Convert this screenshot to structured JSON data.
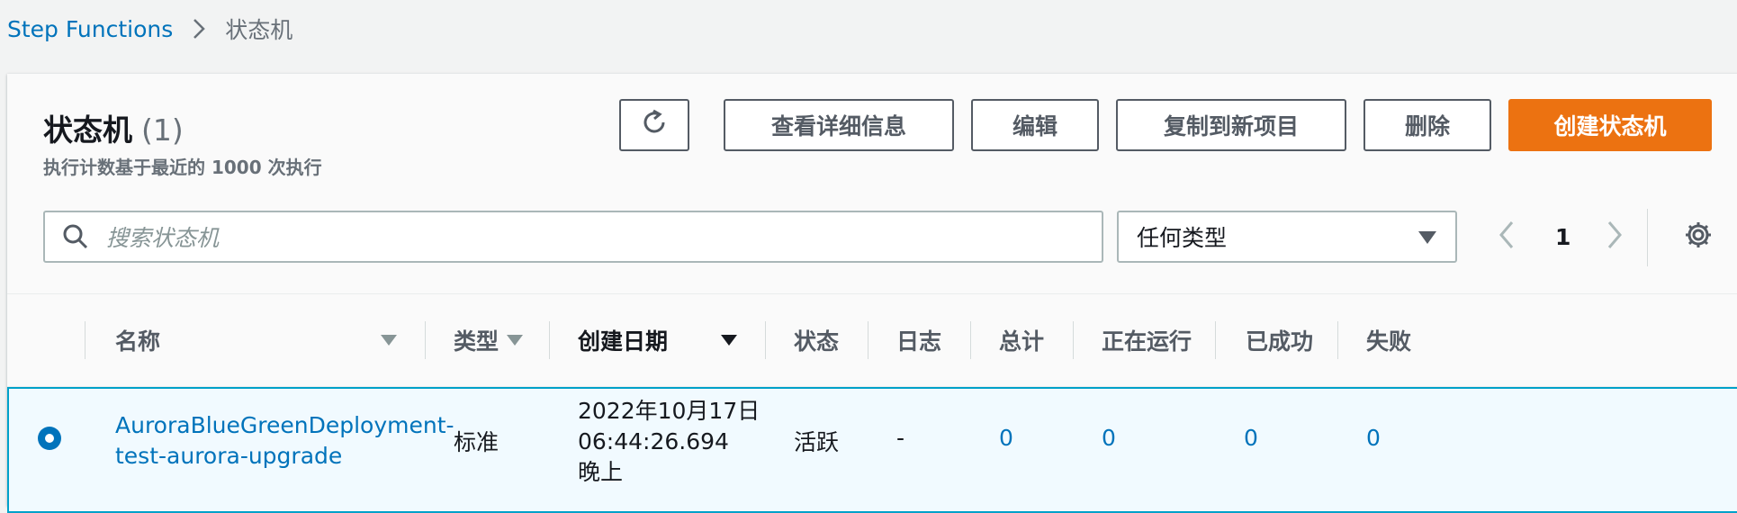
{
  "breadcrumb": {
    "service": "Step Functions",
    "current": "状态机"
  },
  "header": {
    "title": "状态机",
    "count": "(1)",
    "subtitle": "执行计数基于最近的 1000 次执行"
  },
  "toolbar": {
    "view_details": "查看详细信息",
    "edit": "编辑",
    "copy_to_new": "复制到新项目",
    "delete": "删除",
    "create": "创建状态机"
  },
  "search": {
    "placeholder": "搜索状态机"
  },
  "filter": {
    "selected": "任何类型"
  },
  "pagination": {
    "current_page": "1"
  },
  "table": {
    "columns": [
      "名称",
      "类型",
      "创建日期",
      "状态",
      "日志",
      "总计",
      "正在运行",
      "已成功",
      "失败"
    ],
    "rows": [
      {
        "name_line1": "AuroraBlueGreenDeployment-",
        "name_line2": "test-aurora-upgrade",
        "type": "标准",
        "date_line1": "2022年10月17日",
        "date_line2": "06:44:26.694",
        "date_line3": "晚上",
        "status": "活跃",
        "logs": "-",
        "total": "0",
        "running": "0",
        "succeeded": "0",
        "failed": "0"
      }
    ]
  },
  "colors": {
    "link": "#0073bb",
    "primary": "#ec7211",
    "selected_row": "#f1faff"
  }
}
